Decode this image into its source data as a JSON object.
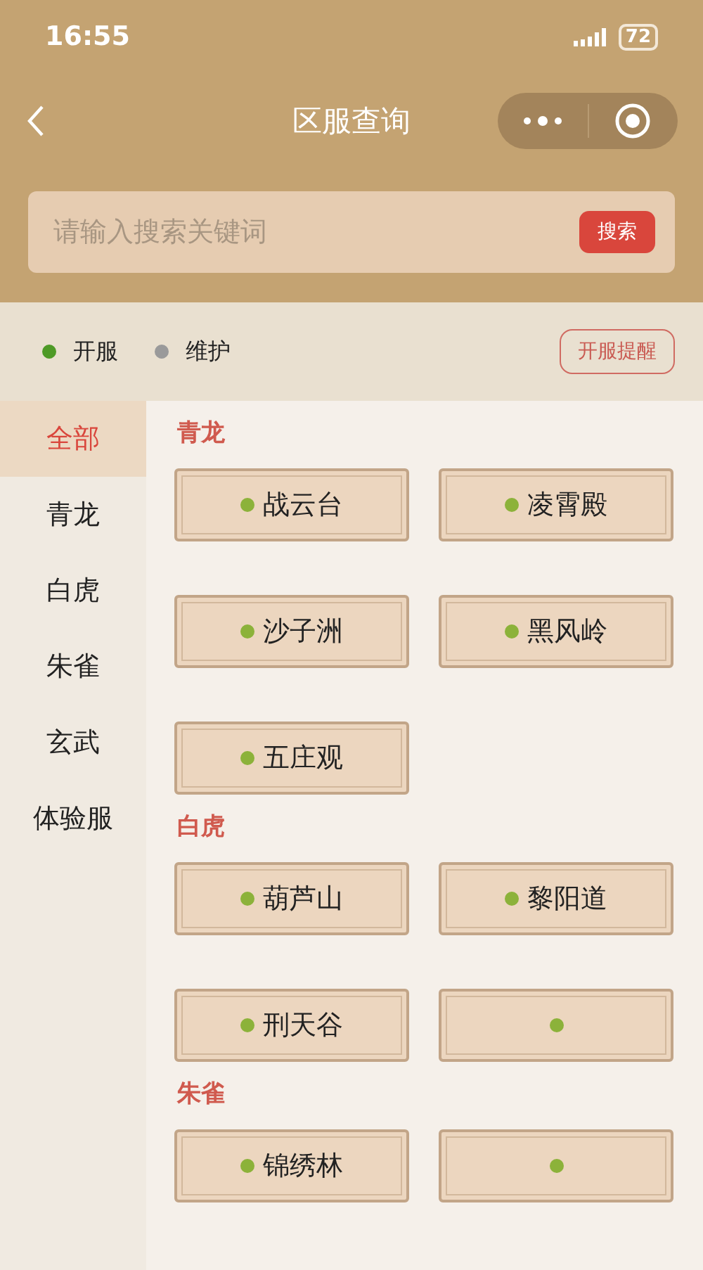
{
  "status_bar": {
    "time": "16:55",
    "battery": "72"
  },
  "nav": {
    "title": "区服查询"
  },
  "search": {
    "placeholder": "请输入搜索关键词",
    "button": "搜索"
  },
  "legend": [
    {
      "label": "开服",
      "color": "#4e9a26"
    },
    {
      "label": "维护",
      "color": "#9a9a9a"
    }
  ],
  "reminder_button": "开服提醒",
  "sidebar": {
    "items": [
      {
        "label": "全部",
        "selected": true
      },
      {
        "label": "青龙",
        "selected": false
      },
      {
        "label": "白虎",
        "selected": false
      },
      {
        "label": "朱雀",
        "selected": false
      },
      {
        "label": "玄武",
        "selected": false
      },
      {
        "label": "体验服",
        "selected": false
      }
    ]
  },
  "sections": [
    {
      "title": "青龙",
      "servers": [
        {
          "name": "战云台",
          "open": true
        },
        {
          "name": "凌霄殿",
          "open": true
        },
        {
          "name": "沙子洲",
          "open": true
        },
        {
          "name": "黑风岭",
          "open": true
        },
        {
          "name": "五庄观",
          "open": true
        }
      ]
    },
    {
      "title": "白虎",
      "servers": [
        {
          "name": "葫芦山",
          "open": true
        },
        {
          "name": "黎阳道",
          "open": true
        },
        {
          "name": "刑天谷",
          "open": true
        },
        {
          "open": true
        }
      ]
    },
    {
      "title": "朱雀",
      "servers": [
        {
          "name": "锦绣林",
          "open": true
        },
        {
          "open": true
        }
      ]
    }
  ]
}
